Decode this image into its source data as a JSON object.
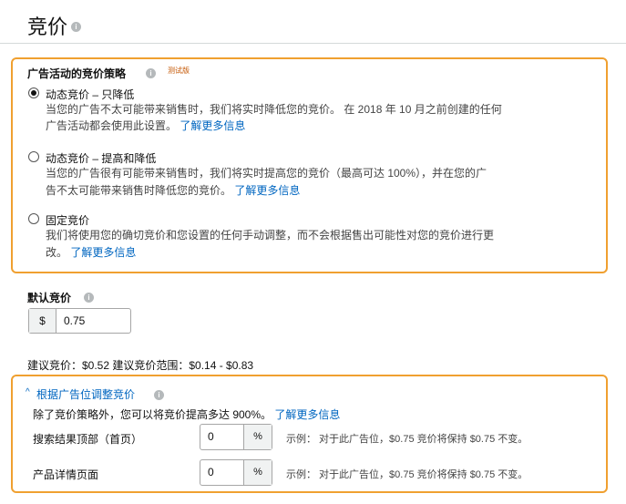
{
  "header": {
    "title": "竞价"
  },
  "strategy": {
    "title": "广告活动的竞价策略",
    "beta": "测试版",
    "options": [
      {
        "label": "动态竞价 – 只降低",
        "selected": true,
        "desc_line1": "当您的广告不太可能带来销售时，我们将实时降低您的竞价。 在 2018 年 10 月之前创建的任何",
        "desc_line2": "广告活动都会使用此设置。",
        "link": "了解更多信息"
      },
      {
        "label": "动态竞价 – 提高和降低",
        "selected": false,
        "desc_line1": "当您的广告很有可能带来销售时，我们将实时提高您的竞价（最高可达 100%），并在您的广",
        "desc_line2": "告不太可能带来销售时降低您的竞价。",
        "link": "了解更多信息"
      },
      {
        "label": "固定竞价",
        "selected": false,
        "desc_line1": "我们将使用您的确切竞价和您设置的任何手动调整，而不会根据售出可能性对您的竞价进行更",
        "desc_line2": "改。",
        "link": "了解更多信息"
      }
    ]
  },
  "default_bid": {
    "label": "默认竞价",
    "currency": "$",
    "value": "0.75"
  },
  "suggested": "建议竞价：$0.52 建议竞价范围：$0.14 - $0.83",
  "placement": {
    "chevron": "^",
    "title": "根据广告位调整竞价",
    "desc": "除了竞价策略外，您可以将竞价提高多达 900%。",
    "link": "了解更多信息",
    "rows": [
      {
        "label": "搜索结果顶部（首页）",
        "value": "0",
        "suffix": "%",
        "example": "示例： 对于此广告位，$0.75 竞价将保持 $0.75 不变。"
      },
      {
        "label": "产品详情页面",
        "value": "0",
        "suffix": "%",
        "example": "示例： 对于此广告位，$0.75 竞价将保持 $0.75 不变。"
      }
    ]
  },
  "colors": {
    "accent_border": "#f0a030",
    "link": "#0066c0",
    "beta": "#c45500"
  }
}
